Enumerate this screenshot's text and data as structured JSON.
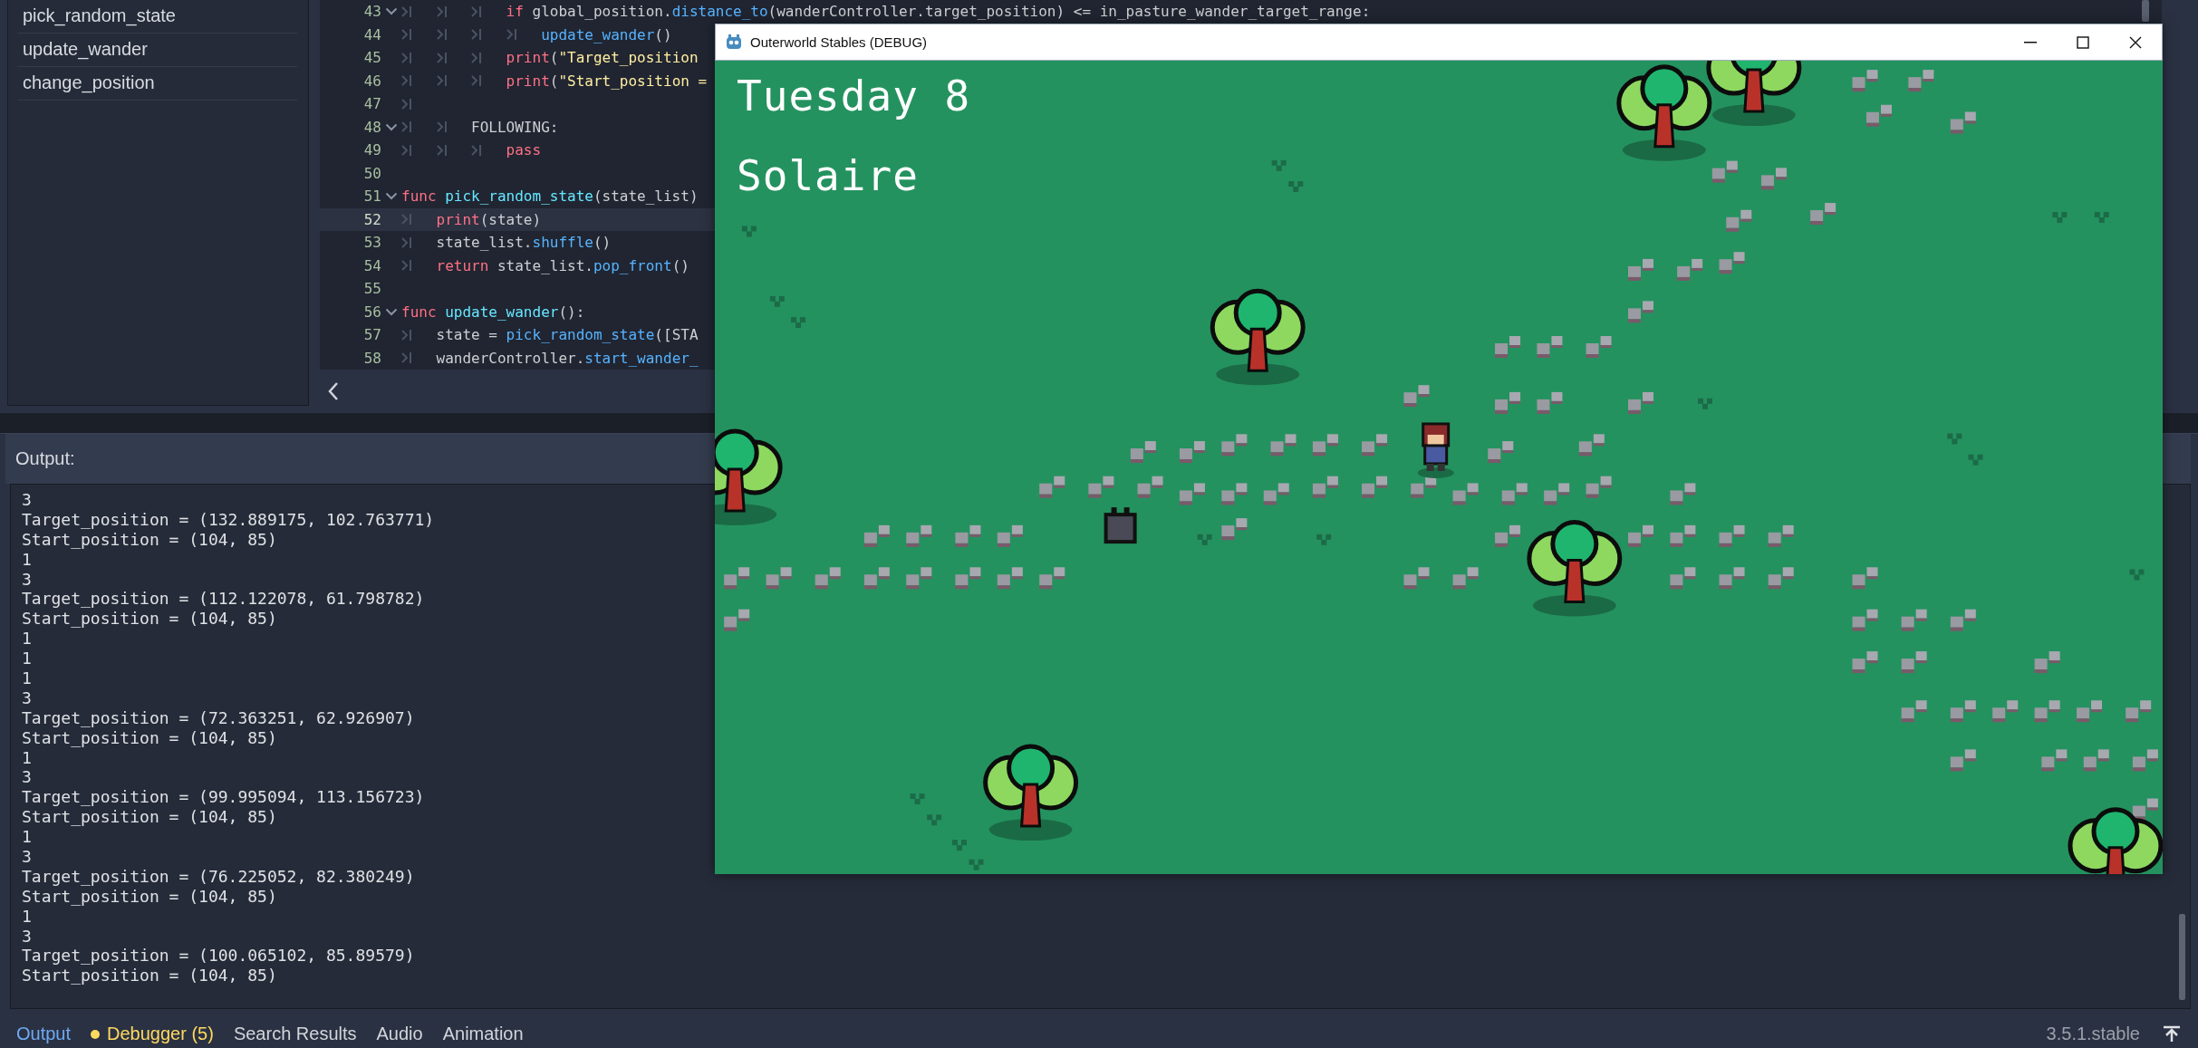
{
  "script_list": {
    "items": [
      "pick_random_state",
      "update_wander",
      "change_position"
    ]
  },
  "code_editor": {
    "lines": [
      {
        "number": "43",
        "foldable": true,
        "current": false,
        "tokens": [
          {
            "kind": "tab"
          },
          {
            "kind": "tab"
          },
          {
            "kind": "tab"
          },
          {
            "kind": "keyword",
            "text": "if"
          },
          {
            "kind": "plain",
            "text": " global_position."
          },
          {
            "kind": "call",
            "text": "distance_to"
          },
          {
            "kind": "plain",
            "text": "(wanderController.target_position) <= in_pasture_wander_target_range:"
          }
        ]
      },
      {
        "number": "44",
        "foldable": false,
        "current": false,
        "tokens": [
          {
            "kind": "tab"
          },
          {
            "kind": "tab"
          },
          {
            "kind": "tab"
          },
          {
            "kind": "tab"
          },
          {
            "kind": "call",
            "text": "update_wander"
          },
          {
            "kind": "plain",
            "text": "()"
          }
        ]
      },
      {
        "number": "45",
        "foldable": false,
        "current": false,
        "tokens": [
          {
            "kind": "tab"
          },
          {
            "kind": "tab"
          },
          {
            "kind": "tab"
          },
          {
            "kind": "keyword",
            "text": "print"
          },
          {
            "kind": "plain",
            "text": "("
          },
          {
            "kind": "string",
            "text": "\"Target_position"
          }
        ]
      },
      {
        "number": "46",
        "foldable": false,
        "current": false,
        "tokens": [
          {
            "kind": "tab"
          },
          {
            "kind": "tab"
          },
          {
            "kind": "tab"
          },
          {
            "kind": "keyword",
            "text": "print"
          },
          {
            "kind": "plain",
            "text": "("
          },
          {
            "kind": "string",
            "text": "\"Start_position ="
          }
        ]
      },
      {
        "number": "47",
        "foldable": false,
        "current": false,
        "tokens": [
          {
            "kind": "tab"
          }
        ]
      },
      {
        "number": "48",
        "foldable": true,
        "current": false,
        "tokens": [
          {
            "kind": "tab"
          },
          {
            "kind": "tab"
          },
          {
            "kind": "plain",
            "text": "FOLLOWING:"
          }
        ]
      },
      {
        "number": "49",
        "foldable": false,
        "current": false,
        "tokens": [
          {
            "kind": "tab"
          },
          {
            "kind": "tab"
          },
          {
            "kind": "tab"
          },
          {
            "kind": "keyword",
            "text": "pass"
          }
        ]
      },
      {
        "number": "50",
        "foldable": false,
        "current": false
      },
      {
        "number": "51",
        "foldable": true,
        "current": false,
        "tokens": [
          {
            "kind": "keyword",
            "text": "func"
          },
          {
            "kind": "def",
            "text": " pick_random_state"
          },
          {
            "kind": "plain",
            "text": "(state_list)"
          }
        ]
      },
      {
        "number": "52",
        "foldable": false,
        "current": true,
        "tokens": [
          {
            "kind": "tab"
          },
          {
            "kind": "keyword",
            "text": "print"
          },
          {
            "kind": "plain",
            "text": "(state)"
          }
        ]
      },
      {
        "number": "53",
        "foldable": false,
        "current": false,
        "tokens": [
          {
            "kind": "tab"
          },
          {
            "kind": "plain",
            "text": "state_list."
          },
          {
            "kind": "call",
            "text": "shuffle"
          },
          {
            "kind": "plain",
            "text": "()"
          }
        ]
      },
      {
        "number": "54",
        "foldable": false,
        "current": false,
        "tokens": [
          {
            "kind": "tab"
          },
          {
            "kind": "keyword",
            "text": "return"
          },
          {
            "kind": "plain",
            "text": " state_list."
          },
          {
            "kind": "call",
            "text": "pop_front"
          },
          {
            "kind": "plain",
            "text": "()"
          }
        ]
      },
      {
        "number": "55",
        "foldable": false,
        "current": false
      },
      {
        "number": "56",
        "foldable": true,
        "current": false,
        "tokens": [
          {
            "kind": "keyword",
            "text": "func"
          },
          {
            "kind": "def",
            "text": " update_wander"
          },
          {
            "kind": "plain",
            "text": "():"
          }
        ]
      },
      {
        "number": "57",
        "foldable": false,
        "current": false,
        "tokens": [
          {
            "kind": "tab"
          },
          {
            "kind": "plain",
            "text": "state = "
          },
          {
            "kind": "call",
            "text": "pick_random_state"
          },
          {
            "kind": "plain",
            "text": "([STA"
          }
        ]
      },
      {
        "number": "58",
        "foldable": false,
        "current": false,
        "tokens": [
          {
            "kind": "tab"
          },
          {
            "kind": "plain",
            "text": "wanderController."
          },
          {
            "kind": "call",
            "text": "start_wander_"
          }
        ]
      }
    ]
  },
  "output": {
    "title": "Output:",
    "lines": [
      "3",
      "Target_position = (132.889175, 102.763771)",
      "Start_position = (104, 85)",
      "1",
      "3",
      "Target_position = (112.122078, 61.798782)",
      "Start_position = (104, 85)",
      "1",
      "1",
      "1",
      "3",
      "Target_position = (72.363251, 62.926907)",
      "Start_position = (104, 85)",
      "1",
      "3",
      "Target_position = (99.995094, 113.156723)",
      "Start_position = (104, 85)",
      "1",
      "3",
      "Target_position = (76.225052, 82.380249)",
      "Start_position = (104, 85)",
      "1",
      "3",
      "Target_position = (100.065102, 85.89579)",
      "Start_position = (104, 85)"
    ]
  },
  "bottom_panel": {
    "tabs": [
      {
        "label": "Output",
        "selected": true,
        "kind": "plain"
      },
      {
        "label": "Debugger (5)",
        "selected": false,
        "kind": "alert"
      },
      {
        "label": "Search Results",
        "selected": false,
        "kind": "plain"
      },
      {
        "label": "Audio",
        "selected": false,
        "kind": "plain"
      },
      {
        "label": "Animation",
        "selected": false,
        "kind": "plain"
      }
    ],
    "version": "3.5.1.stable"
  },
  "game_window": {
    "title": "Outerworld Stables (DEBUG)",
    "hud": [
      "Tuesday 8",
      "Solaire"
    ]
  }
}
